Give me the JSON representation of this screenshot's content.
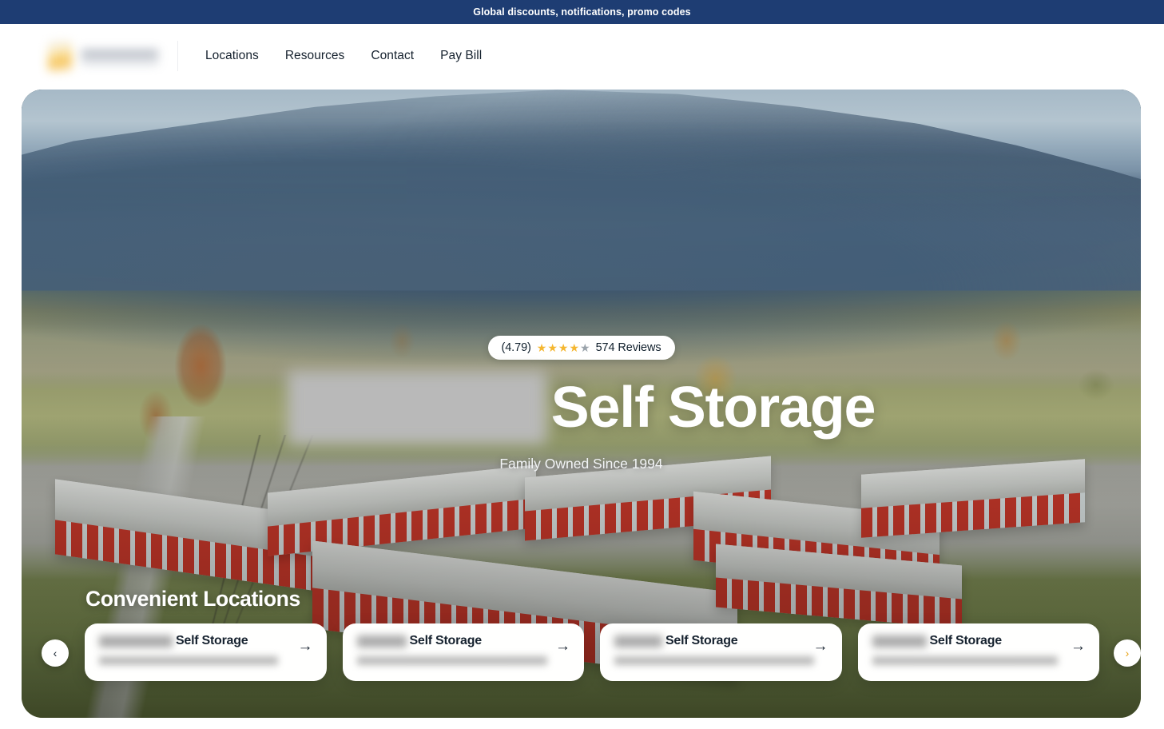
{
  "promo_banner": {
    "text": "Global discounts, notifications, promo codes",
    "background_color": "#1e3d73",
    "text_color": "#ffffff"
  },
  "header": {
    "logo": {
      "name": "brand-logo",
      "state": "redacted-blurred",
      "mark_color": "#f6c14e",
      "wordmark_color": "#b0b6c0"
    },
    "nav": [
      {
        "label": "Locations"
      },
      {
        "label": "Resources"
      },
      {
        "label": "Contact"
      },
      {
        "label": "Pay Bill"
      }
    ]
  },
  "hero": {
    "image_description": "Aerial photograph of a self storage facility with red roll-up doors, mountains and autumn treeline in background",
    "rating": {
      "score_text": "(4.79)",
      "stars_filled": 4,
      "stars_total": 5,
      "star_filled_color": "#f5b731",
      "star_empty_color": "#9aa3ab",
      "reviews_text": "574 Reviews"
    },
    "title_brand": "",
    "title_brand_state": "redacted-blurred",
    "title_suffix": "Self Storage",
    "subtitle": "Family Owned Since 1994"
  },
  "locations": {
    "heading": "Convenient Locations",
    "prev_icon": "‹",
    "next_icon": "›",
    "next_icon_color": "#e8a317",
    "cards": [
      {
        "name": "",
        "name_state": "redacted-blurred",
        "name_redacted_width": 92,
        "suffix": "Self Storage",
        "address": "",
        "address_state": "redacted-blurred",
        "address_redacted_width": 224,
        "arrow_icon": "→"
      },
      {
        "name": "",
        "name_state": "redacted-blurred",
        "name_redacted_width": 62,
        "suffix": "Self Storage",
        "address": "",
        "address_state": "redacted-blurred",
        "address_redacted_width": 238,
        "arrow_icon": "→"
      },
      {
        "name": "",
        "name_state": "redacted-blurred",
        "name_redacted_width": 60,
        "suffix": "Self Storage",
        "address": "",
        "address_state": "redacted-blurred",
        "address_redacted_width": 250,
        "arrow_icon": "→"
      },
      {
        "name": "",
        "name_state": "redacted-blurred",
        "name_redacted_width": 68,
        "suffix": "Self Storage",
        "address": "",
        "address_state": "redacted-blurred",
        "address_redacted_width": 232,
        "arrow_icon": "→"
      }
    ]
  }
}
